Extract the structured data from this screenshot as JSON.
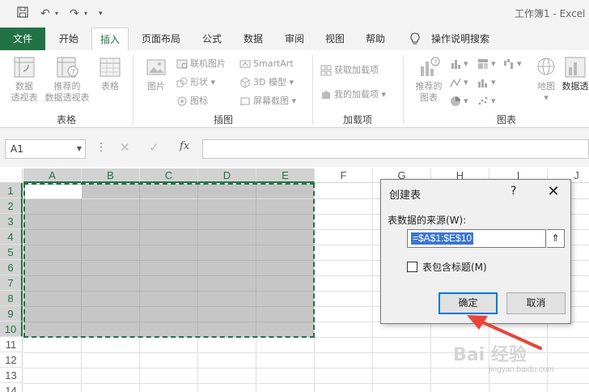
{
  "window": {
    "title": "工作簿1 - Excel"
  },
  "tabs": [
    {
      "label": "文件"
    },
    {
      "label": "开始"
    },
    {
      "label": "插入"
    },
    {
      "label": "页面布局"
    },
    {
      "label": "公式"
    },
    {
      "label": "数据"
    },
    {
      "label": "审阅"
    },
    {
      "label": "视图"
    },
    {
      "label": "帮助"
    },
    {
      "label": "操作说明搜索"
    }
  ],
  "ribbon": {
    "groups": {
      "tables": "表格",
      "illustrations": "插图",
      "addins": "加载项",
      "charts": "图表"
    },
    "pivot_table": [
      "数据",
      "透视表"
    ],
    "recommended_pivot": [
      "推荐的",
      "数据透视表"
    ],
    "table": "表格",
    "picture": "图片",
    "online_pictures": "联机图片",
    "shapes": "形状",
    "icons": "图标",
    "smartart": "SmartArt",
    "model_3d": "3D 模型",
    "screenshot": "屏幕截图",
    "get_addins": "获取加载项",
    "my_addins": "我的加载项",
    "recommended_charts": [
      "推荐的",
      "图表"
    ],
    "map": "地图",
    "pivot_chart": "数据透"
  },
  "formula_bar": {
    "name_box": "A1",
    "fx": "fx"
  },
  "grid": {
    "columns": [
      "A",
      "B",
      "C",
      "D",
      "E",
      "F",
      "G",
      "H",
      "I",
      "J"
    ],
    "rows": [
      "1",
      "2",
      "3",
      "4",
      "5",
      "6",
      "7",
      "8",
      "9",
      "10",
      "11",
      "12",
      "13",
      "14"
    ]
  },
  "dialog": {
    "title": "创建表",
    "help": "?",
    "close": "✕",
    "source_label": "表数据的来源(W):",
    "range": "=$A$1:$E$10",
    "collapse": "⇑",
    "has_headers_label": "表包含标题(M)",
    "has_headers_checked": false,
    "ok": "确定",
    "cancel": "取消"
  },
  "watermark": {
    "text": "Bai 经验",
    "sub": "jingyan.baidu.com"
  },
  "colors": {
    "excel_green": "#217346",
    "annotation_red": "#e8443a",
    "selection_gray": "#c6c6c6"
  }
}
